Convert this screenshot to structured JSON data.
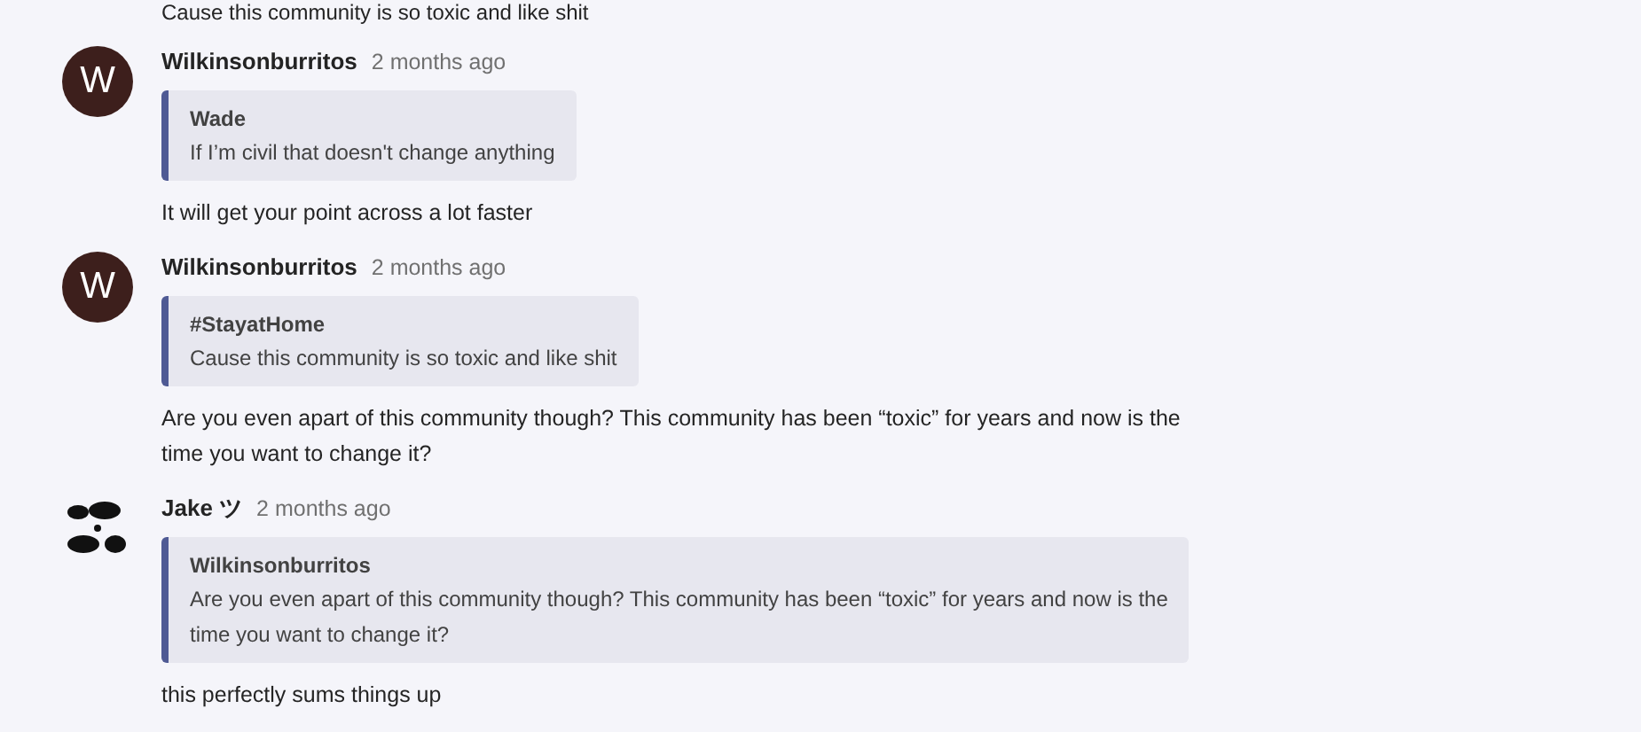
{
  "previous_text": "Cause this community is so toxic and like shit",
  "messages": [
    {
      "avatar": {
        "kind": "letter",
        "letter": "W"
      },
      "author": "Wilkinsonburritos",
      "time": "2 months ago",
      "quote": {
        "author": "Wade",
        "lines": [
          "If I’m civil that doesn't change anything"
        ]
      },
      "lines": [
        "It will get your point across a lot faster"
      ]
    },
    {
      "avatar": {
        "kind": "letter",
        "letter": "W"
      },
      "author": "Wilkinsonburritos",
      "time": "2 months ago",
      "quote": {
        "author": "#StayatHome",
        "lines": [
          "Cause this community is so toxic and like shit"
        ]
      },
      "lines": [
        "Are you even apart of this community though? This community has been “toxic” for years and now is the",
        "time you want to change it?"
      ]
    },
    {
      "avatar": {
        "kind": "picture"
      },
      "author": "Jake ツ",
      "time": "2 months ago",
      "quote": {
        "author": "Wilkinsonburritos",
        "lines": [
          "Are you even apart of this community though? This community has been “toxic” for years and now is the",
          "time you want to change it?"
        ]
      },
      "lines": [
        "this perfectly sums things up"
      ]
    }
  ]
}
